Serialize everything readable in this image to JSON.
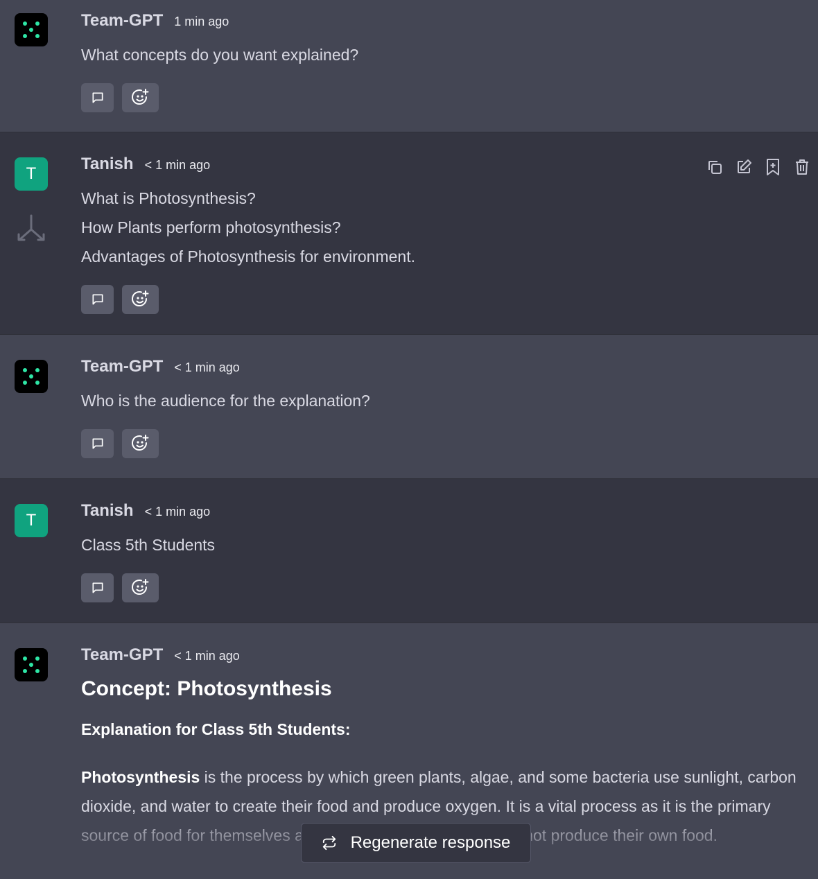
{
  "messages": [
    {
      "sender": "Team-GPT",
      "time": "1 min ago",
      "lines": [
        "What concepts do you want explained?"
      ]
    },
    {
      "sender": "Tanish",
      "avatar_letter": "T",
      "time": "< 1 min ago",
      "lines": [
        "What is Photosynthesis?",
        "How Plants perform photosynthesis?",
        "Advantages of Photosynthesis for environment."
      ]
    },
    {
      "sender": "Team-GPT",
      "time": "< 1 min ago",
      "lines": [
        "Who is the audience for the explanation?"
      ]
    },
    {
      "sender": "Tanish",
      "avatar_letter": "T",
      "time": "< 1 min ago",
      "lines": [
        "Class 5th Students"
      ]
    },
    {
      "sender": "Team-GPT",
      "time": "< 1 min ago",
      "heading": "Concept: Photosynthesis",
      "subheading": "Explanation for Class 5th Students:",
      "para_bold": "Photosynthesis",
      "para_rest": " is the process by which green plants, algae, and some bacteria use sunlight, carbon dioxide, and water to create their food and produce oxygen. It is a vital process as it is the primary source of food for themselves and for other organisms that cannot produce their own food."
    }
  ],
  "regenerate_label": "Regenerate response",
  "icons": {
    "action_buttons": [
      "comment-icon",
      "add-reaction-icon"
    ],
    "message_tools": [
      "copy-icon",
      "edit-icon",
      "bookmark-add-icon",
      "trash-icon"
    ],
    "side": "branch-icon",
    "regenerate": "regenerate-icon"
  },
  "colors": {
    "bot_bg": "#444654",
    "user_bg": "#343541",
    "user_avatar": "#10a37f",
    "bot_dots": "#2ee6a6"
  }
}
